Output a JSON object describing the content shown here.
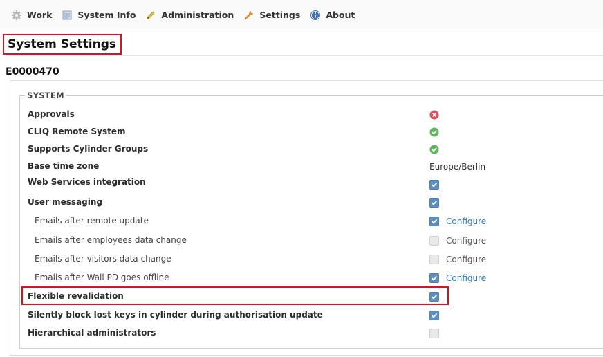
{
  "menu": {
    "items": [
      {
        "label": "Work",
        "icon": "gear-icon"
      },
      {
        "label": "System Info",
        "icon": "document-icon"
      },
      {
        "label": "Administration",
        "icon": "pencil-icon"
      },
      {
        "label": "Settings",
        "icon": "wrench-icon"
      },
      {
        "label": "About",
        "icon": "info-icon"
      }
    ]
  },
  "page": {
    "title": "System Settings",
    "code": "E0000470"
  },
  "system": {
    "legend": "SYSTEM",
    "rows": {
      "approvals": {
        "label": "Approvals",
        "status": "disabled"
      },
      "cliq": {
        "label": "CLIQ Remote System",
        "status": "enabled"
      },
      "cylinder_groups": {
        "label": "Supports Cylinder Groups",
        "status": "enabled"
      },
      "timezone": {
        "label": "Base time zone",
        "value": "Europe/Berlin"
      },
      "web_services": {
        "label": "Web Services integration",
        "checked": true
      },
      "user_messaging": {
        "label": "User messaging",
        "checked": true
      },
      "emails_remote": {
        "label": "Emails after remote update",
        "checked": true,
        "configure": "Configure"
      },
      "emails_employees": {
        "label": "Emails after employees data change",
        "checked": false,
        "configure": "Configure"
      },
      "emails_visitors": {
        "label": "Emails after visitors data change",
        "checked": false,
        "configure": "Configure"
      },
      "emails_wallpd": {
        "label": "Emails after Wall PD goes offline",
        "checked": true,
        "configure": "Configure"
      },
      "flexible_revalidation": {
        "label": "Flexible revalidation",
        "checked": true
      },
      "silently_block": {
        "label": "Silently block lost keys in cylinder during authorisation update",
        "checked": true
      },
      "hierarchical_admins": {
        "label": "Hierarchical administrators",
        "checked": false
      }
    }
  },
  "colors": {
    "accent_link": "#2a7ec1",
    "checkbox_on": "#5b8fc3",
    "status_ok": "#5cb85c",
    "status_error": "#e0505a",
    "highlight": "#d9141b"
  }
}
